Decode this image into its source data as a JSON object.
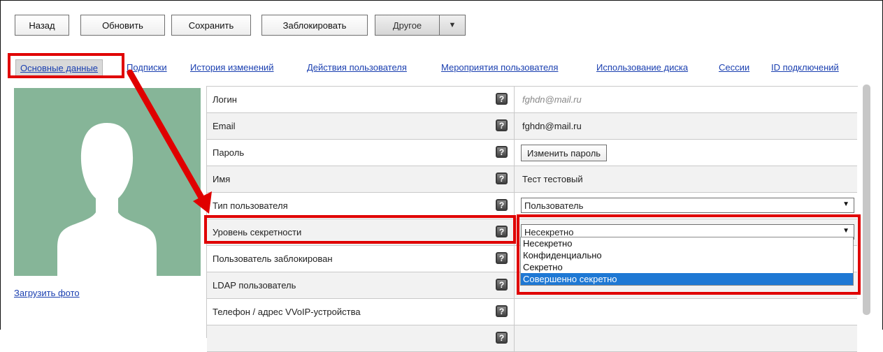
{
  "toolbar": {
    "back": "Назад",
    "refresh": "Обновить",
    "save": "Сохранить",
    "block": "Заблокировать",
    "other": "Другое",
    "other_arrow": "▼"
  },
  "tabs": [
    {
      "label": "Основные данные",
      "active": true
    },
    {
      "label": "Подписки"
    },
    {
      "label": "История изменений"
    },
    {
      "label": "Действия пользователя"
    },
    {
      "label": "Мероприятия пользователя"
    },
    {
      "label": "Использование диска"
    },
    {
      "label": "Сессии"
    },
    {
      "label": "ID подключений"
    }
  ],
  "photo": {
    "upload_label": "Загрузить фото",
    "background": "#86b598"
  },
  "help_glyph": "?",
  "fields": {
    "login": {
      "label": "Логин",
      "placeholder": "fghdn@mail.ru"
    },
    "email": {
      "label": "Email",
      "value": "fghdn@mail.ru"
    },
    "password": {
      "label": "Пароль",
      "button": "Изменить пароль"
    },
    "name": {
      "label": "Имя",
      "value": "Тест тестовый"
    },
    "user_type": {
      "label": "Тип пользователя",
      "value": "Пользователь"
    },
    "secrecy": {
      "label": "Уровень секретности",
      "value": "Несекретно",
      "options": [
        "Несекретно",
        "Конфиденциально",
        "Секретно",
        "Совершенно секретно"
      ],
      "highlighted_option": "Совершенно секретно"
    },
    "blocked": {
      "label": "Пользователь заблокирован"
    },
    "ldap": {
      "label": "LDAP пользователь"
    },
    "phone": {
      "label": "Телефон / адрес VVoIP-устройства"
    }
  },
  "caret_glyph": "▼",
  "colors": {
    "highlight": "#e00000",
    "link": "#1a3fb0",
    "selected_option": "#1e78d4"
  }
}
